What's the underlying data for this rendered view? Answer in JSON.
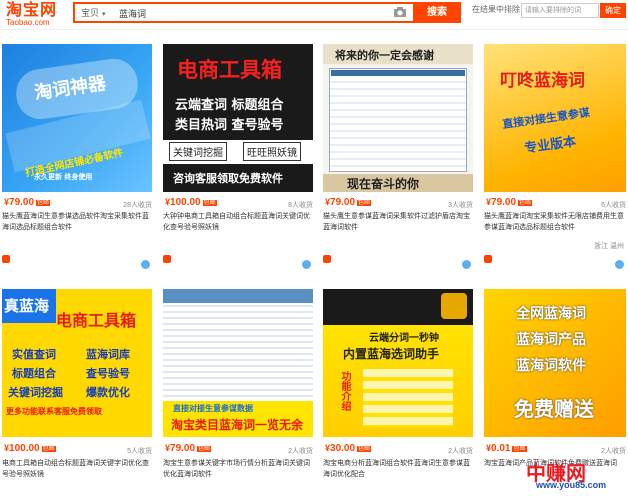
{
  "header": {
    "logo_cn": "淘宝网",
    "logo_en": "Taobao.com",
    "search_scope": "宝贝",
    "search_query": "蓝海词",
    "search_button": "搜索",
    "filter_label": "在结果中排除",
    "filter_placeholder": "请输入要排除的词",
    "filter_button": "确定"
  },
  "products": [
    {
      "price": "79.00",
      "buyers": "28人收货",
      "title": "猫头鹰蓝海词生意参谋选品软件淘宝采集软件蓝海词选品标题组合软件",
      "thumb": {
        "l1": "淘词神器",
        "l2": "打造全网店铺必备软件",
        "l3": "永久更新 终身使用"
      }
    },
    {
      "price": "100.00",
      "buyers": "8人收货",
      "title": "大钟钟电商工具箱自动组合标题蓝海词关键词优化查号验号照妖镜",
      "thumb": {
        "l1": "电商工具箱",
        "l2": "云端查词 标题组合",
        "l3": "类目热词 查号验号",
        "l4": "关键词挖掘",
        "l5": "旺旺照妖镜",
        "l6": "咨询客服领取免费软件"
      }
    },
    {
      "price": "79.00",
      "buyers": "3人收货",
      "title": "猫头鹰生意参谋蓝海词采集软件过滤护盾店淘宝蓝海词软件",
      "thumb": {
        "l1": "将来的你一定会感谢",
        "l2": "现在奋斗的你"
      }
    },
    {
      "price": "79.00",
      "buyers": "6人收货",
      "title": "猫头鹰蓝海词淘宝采集软件无限店铺费用生意参谋蓝海词选品标题组合软件",
      "thumb": {
        "l1": "叮咚蓝海词",
        "l2": "直接对接生意参谋",
        "l3": "专业版本"
      }
    },
    {
      "price": "100.00",
      "buyers": "5人收货",
      "title": "电商工具箱自动组合标题蓝海词关键字词优化查号验号照妖镜",
      "thumb": {
        "l1": "真蓝海",
        "l2": "电商工具箱",
        "l3": "实值查词",
        "l4": "蓝海词库",
        "l5": "标题组合",
        "l6": "查号验号",
        "l7": "关键词挖掘",
        "l8": "爆款优化",
        "l9": "更多功能联系客服免费领取"
      }
    },
    {
      "price": "79.00",
      "buyers": "2人收货",
      "title": "淘宝生意参谋关键字市场行情分析蓝海词关键词优化蓝海词软件",
      "thumb": {
        "l1": "直接对接生意参谋数据",
        "l2": "淘宝类目蓝海词一览无余"
      }
    },
    {
      "price": "30.00",
      "buyers": "2人收货",
      "title": "淘宝电商分析蓝海词组合软件蓝海词生意参谋蓝海词优化配合",
      "thumb": {
        "l1": "云端分词一秒钟",
        "l2": "内置蓝海选词助手",
        "l3": "功能介绍"
      }
    },
    {
      "price": "0.01",
      "buyers": "2人收货",
      "title": "淘宝蓝海词产品蓝海词软件免费赠送蓝海词",
      "thumb": {
        "l1": "全网蓝海词",
        "l2": "蓝海词产品",
        "l3": "蓝海词软件",
        "l4": "免费赠送"
      }
    }
  ],
  "shipping_label": "包邮",
  "location_text": "浙江 温州",
  "watermark": {
    "brand": "中赚网",
    "url": "www.you85.com"
  },
  "colors": {
    "accent": "#ff4400",
    "link": "#3366cc"
  }
}
